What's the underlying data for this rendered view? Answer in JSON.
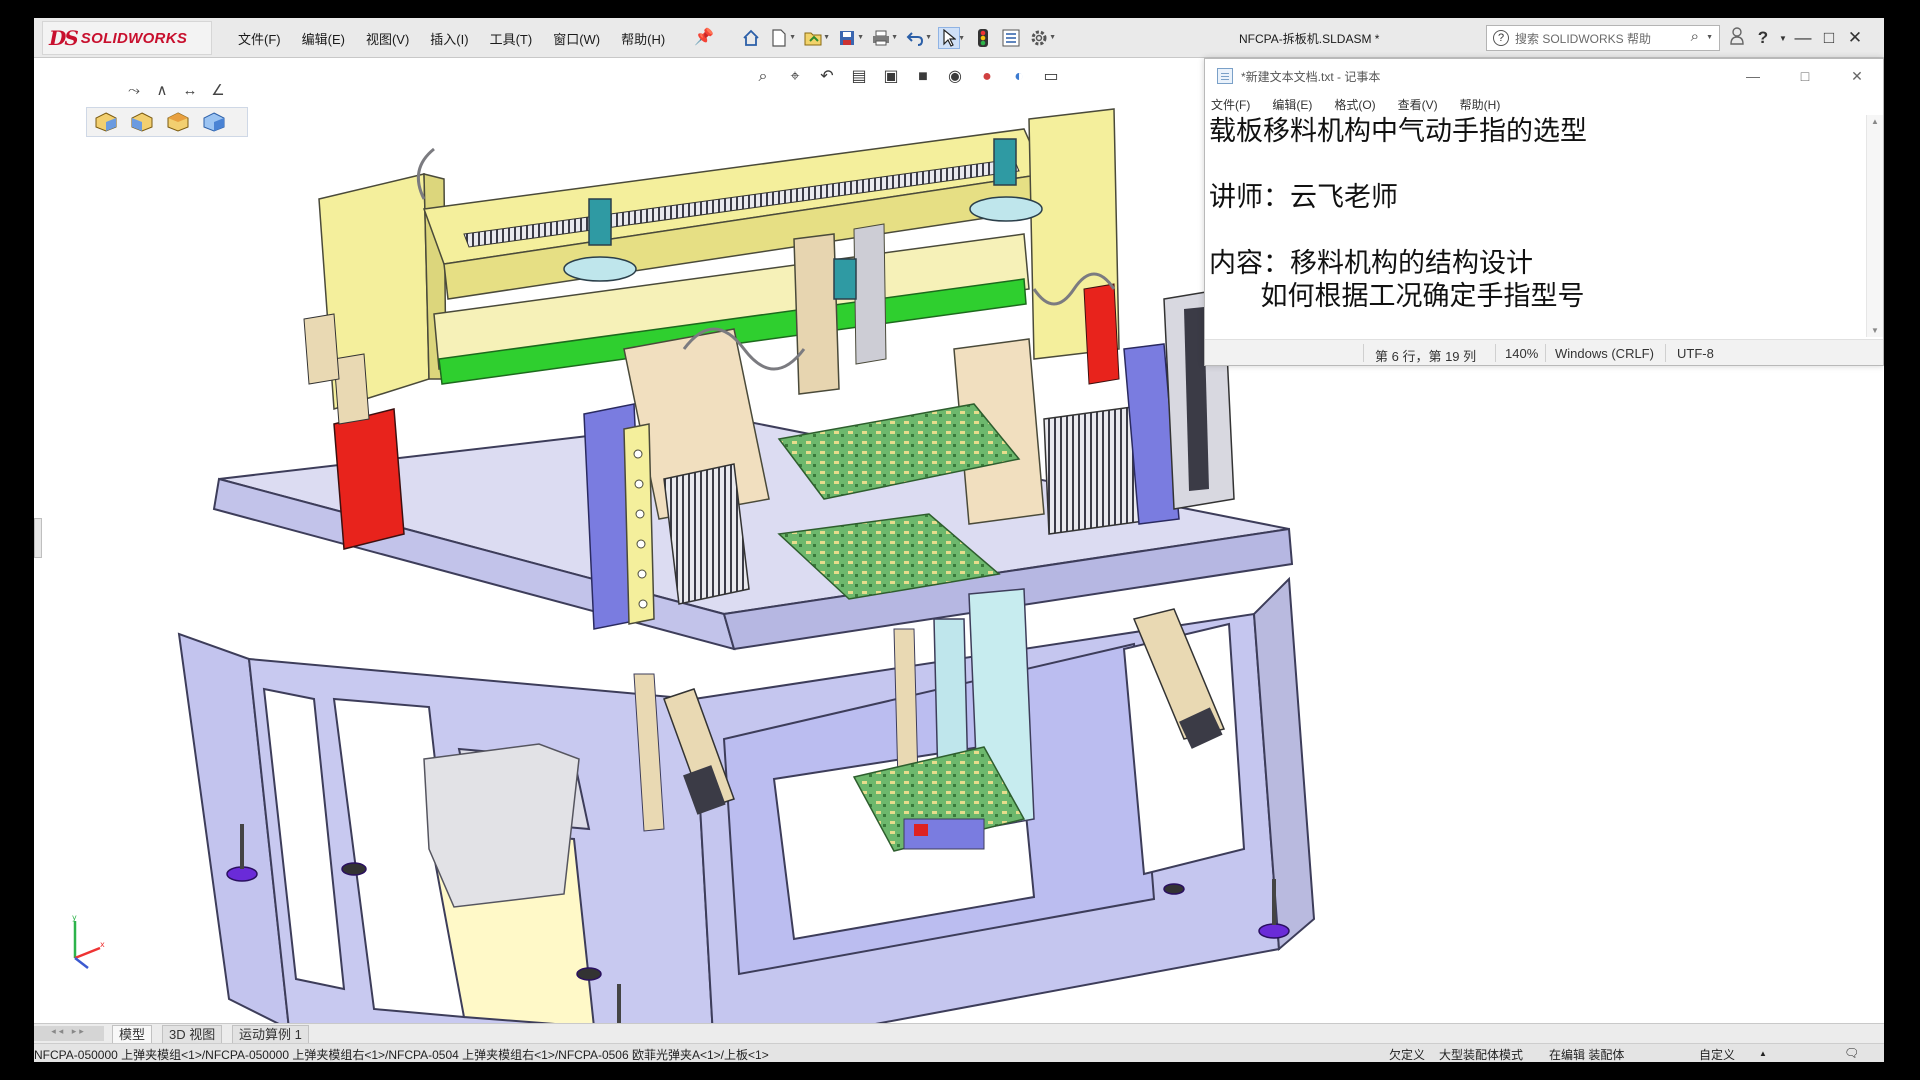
{
  "app": {
    "logo_prefix": "DS",
    "logo_name": "SOLIDWORKS",
    "document_title": "NFCPA-拆板机.SLDASM *",
    "search_placeholder": "搜索 SOLIDWORKS 帮助",
    "search_help_glyph": "?"
  },
  "menu": [
    "文件(F)",
    "编辑(E)",
    "视图(V)",
    "插入(I)",
    "工具(T)",
    "窗口(W)",
    "帮助(H)"
  ],
  "toolbar_icons": [
    "home-icon",
    "new-document-icon",
    "open-icon",
    "save-icon",
    "print-icon",
    "undo-icon",
    "select-icon",
    "rebuild-icon",
    "file-properties-icon",
    "options-icon"
  ],
  "heads_up_icons": [
    "zoom-to-fit-icon",
    "zoom-area-icon",
    "previous-view-icon",
    "section-view-icon",
    "view-orientation-icon",
    "display-style-icon",
    "hide-show-icon",
    "edit-appearance-icon",
    "apply-scene-icon",
    "view-settings-icon"
  ],
  "right_icons": [
    "user-icon",
    "help-icon",
    "minimize-icon",
    "restore-icon",
    "close-icon"
  ],
  "notepad": {
    "title": "*新建文本文档.txt - 记事本",
    "menu": [
      "文件(F)",
      "编辑(E)",
      "格式(O)",
      "查看(V)",
      "帮助(H)"
    ],
    "lines": [
      "载板移料机构中气动手指的选型",
      "",
      "讲师：云飞老师",
      "",
      "内容：移料机构的结构设计",
      "      如何根据工况确定手指型号"
    ],
    "status": {
      "position": "第 6 行，第 19 列",
      "zoom": "140%",
      "line_ending": "Windows (CRLF)",
      "encoding": "UTF-8"
    }
  },
  "tabs": [
    "模型",
    "3D 视图",
    "运动算例 1"
  ],
  "tab_nav": "◂◂ ▸▸",
  "status_bar": {
    "path": "NFCPA-050000 上弹夹模组<1>/NFCPA-050000 上弹夹模组右<1>/NFCPA-0504 上弹夹模组右<1>/NFCPA-0506 欧菲光弹夹A<1>/上板<1>",
    "defined": "欠定义",
    "mode": "大型装配体模式",
    "editing": "在编辑 装配体",
    "custom": "自定义"
  },
  "colors": {
    "frame": "#c8c9f0",
    "frame_edge": "#4a4a6a",
    "yellow_beam": "#f4ef9c",
    "red_block": "#e8231c",
    "green_strip": "#2fcf2f",
    "pcb": "#5ea85e",
    "blue_panel": "#7a7ce0",
    "foot": "#6a2bd8"
  }
}
